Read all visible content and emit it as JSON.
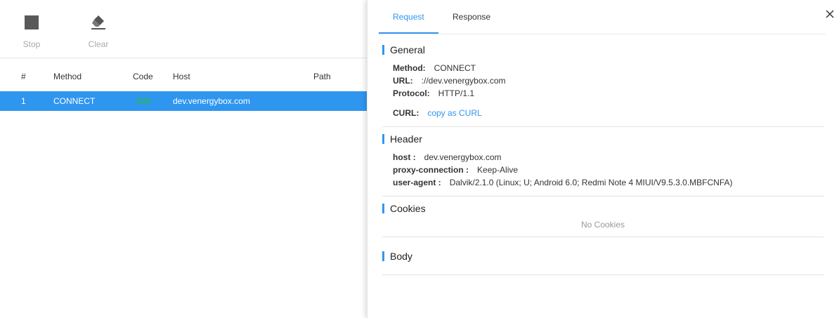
{
  "toolbar": {
    "stop_label": "Stop",
    "clear_label": "Clear"
  },
  "table": {
    "headers": [
      "#",
      "Method",
      "Code",
      "Host",
      "Path"
    ],
    "rows": [
      {
        "num": "1",
        "method": "CONNECT",
        "code": "200",
        "host": "dev.venergybox.com",
        "path": ""
      }
    ],
    "selected_row_color": "#2f96f0",
    "code_color": "#23c223"
  },
  "detail": {
    "tabs": [
      "Request",
      "Response"
    ],
    "active_tab": "Request",
    "general": {
      "title": "General",
      "method_key": "Method:",
      "method_val": "CONNECT",
      "url_key": "URL:",
      "url_val": "://dev.venergybox.com",
      "protocol_key": "Protocol:",
      "protocol_val": "HTTP/1.1",
      "curl_key": "CURL:",
      "curl_val": "copy as CURL"
    },
    "header": {
      "title": "Header",
      "items": [
        {
          "key": "host :",
          "value": "dev.venergybox.com"
        },
        {
          "key": "proxy-connection :",
          "value": "Keep-Alive"
        },
        {
          "key": "user-agent :",
          "value": "Dalvik/2.1.0 (Linux; U; Android 6.0; Redmi Note 4 MIUI/V9.5.3.0.MBFCNFA)"
        }
      ]
    },
    "cookies": {
      "title": "Cookies",
      "empty_text": "No Cookies"
    },
    "body": {
      "title": "Body"
    },
    "accent_color": "#2f96f0"
  }
}
